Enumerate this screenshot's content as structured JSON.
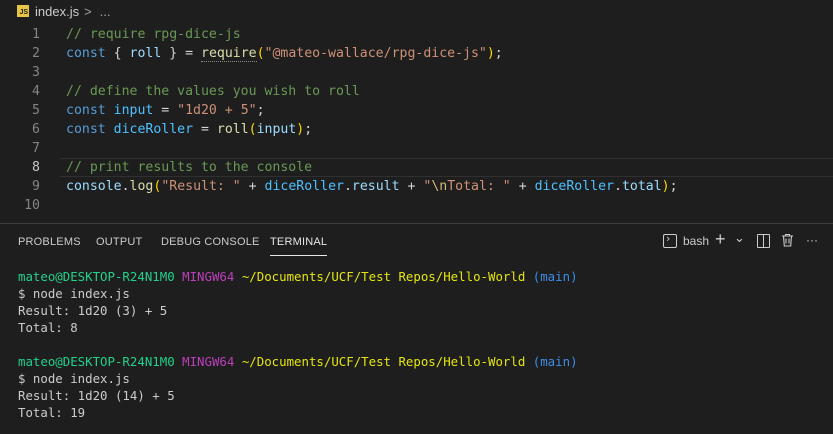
{
  "breadcrumb": {
    "file_icon": "JS",
    "file": "index.js",
    "separator": ">",
    "more": "..."
  },
  "editor": {
    "lines": [
      {
        "num": "1",
        "tokens": [
          {
            "t": "// require rpg-dice-js",
            "c": "c-com"
          }
        ]
      },
      {
        "num": "2",
        "tokens": [
          {
            "t": "const ",
            "c": "c-kw"
          },
          {
            "t": "{ ",
            "c": "c-punc"
          },
          {
            "t": "roll",
            "c": "c-var"
          },
          {
            "t": " } = ",
            "c": "c-punc"
          },
          {
            "t": "require",
            "c": "c-fn dotted"
          },
          {
            "t": "(",
            "c": "c-brace"
          },
          {
            "t": "\"@mateo-wallace/rpg-dice-js\"",
            "c": "c-str"
          },
          {
            "t": ")",
            "c": "c-brace"
          },
          {
            "t": ";",
            "c": "c-punc"
          }
        ]
      },
      {
        "num": "3",
        "tokens": []
      },
      {
        "num": "4",
        "tokens": [
          {
            "t": "// define the values you wish to roll",
            "c": "c-com"
          }
        ]
      },
      {
        "num": "5",
        "tokens": [
          {
            "t": "const ",
            "c": "c-kw"
          },
          {
            "t": "input",
            "c": "c-const"
          },
          {
            "t": " = ",
            "c": "c-punc"
          },
          {
            "t": "\"1d20 + 5\"",
            "c": "c-str"
          },
          {
            "t": ";",
            "c": "c-punc"
          }
        ]
      },
      {
        "num": "6",
        "tokens": [
          {
            "t": "const ",
            "c": "c-kw"
          },
          {
            "t": "diceRoller",
            "c": "c-const"
          },
          {
            "t": " = ",
            "c": "c-punc"
          },
          {
            "t": "roll",
            "c": "c-fn"
          },
          {
            "t": "(",
            "c": "c-brace"
          },
          {
            "t": "input",
            "c": "c-var"
          },
          {
            "t": ")",
            "c": "c-brace"
          },
          {
            "t": ";",
            "c": "c-punc"
          }
        ]
      },
      {
        "num": "7",
        "tokens": []
      },
      {
        "num": "8",
        "current": true,
        "tokens": [
          {
            "t": "// print results to the console",
            "c": "c-com"
          }
        ]
      },
      {
        "num": "9",
        "tokens": [
          {
            "t": "console",
            "c": "c-var"
          },
          {
            "t": ".",
            "c": "c-punc"
          },
          {
            "t": "log",
            "c": "c-fn"
          },
          {
            "t": "(",
            "c": "c-brace"
          },
          {
            "t": "\"Result: \"",
            "c": "c-str"
          },
          {
            "t": " + ",
            "c": "c-punc"
          },
          {
            "t": "diceRoller",
            "c": "c-const"
          },
          {
            "t": ".",
            "c": "c-punc"
          },
          {
            "t": "result",
            "c": "c-var"
          },
          {
            "t": " + ",
            "c": "c-punc"
          },
          {
            "t": "\"",
            "c": "c-str"
          },
          {
            "t": "\\n",
            "c": "c-esc"
          },
          {
            "t": "Total: \"",
            "c": "c-str"
          },
          {
            "t": " + ",
            "c": "c-punc"
          },
          {
            "t": "diceRoller",
            "c": "c-const"
          },
          {
            "t": ".",
            "c": "c-punc"
          },
          {
            "t": "total",
            "c": "c-var"
          },
          {
            "t": ")",
            "c": "c-brace"
          },
          {
            "t": ";",
            "c": "c-punc"
          }
        ]
      },
      {
        "num": "10",
        "tokens": []
      }
    ]
  },
  "panel": {
    "tabs": [
      {
        "label": "PROBLEMS"
      },
      {
        "label": "OUTPUT"
      },
      {
        "label": "DEBUG CONSOLE"
      },
      {
        "label": "TERMINAL",
        "active": true
      }
    ],
    "actions": {
      "shell": "bash",
      "add": "+",
      "dropdown": "⌄",
      "more": "···"
    },
    "terminal": [
      [
        {
          "t": "mateo@DESKTOP-R24N1M0",
          "c": "t-user"
        },
        {
          "t": " "
        },
        {
          "t": "MINGW64",
          "c": "t-sys"
        },
        {
          "t": " "
        },
        {
          "t": "~/Documents/UCF/Test Repos/Hello-World",
          "c": "t-path"
        },
        {
          "t": " "
        },
        {
          "t": "(main)",
          "c": "t-branch"
        }
      ],
      [
        {
          "t": "$ node index.js"
        }
      ],
      [
        {
          "t": "Result: 1d20 (3) + 5"
        }
      ],
      [
        {
          "t": "Total: 8"
        }
      ],
      [],
      [
        {
          "t": "mateo@DESKTOP-R24N1M0",
          "c": "t-user"
        },
        {
          "t": " "
        },
        {
          "t": "MINGW64",
          "c": "t-sys"
        },
        {
          "t": " "
        },
        {
          "t": "~/Documents/UCF/Test Repos/Hello-World",
          "c": "t-path"
        },
        {
          "t": " "
        },
        {
          "t": "(main)",
          "c": "t-branch"
        }
      ],
      [
        {
          "t": "$ node index.js"
        }
      ],
      [
        {
          "t": "Result: 1d20 (14) + 5"
        }
      ],
      [
        {
          "t": "Total: 19"
        }
      ]
    ]
  }
}
